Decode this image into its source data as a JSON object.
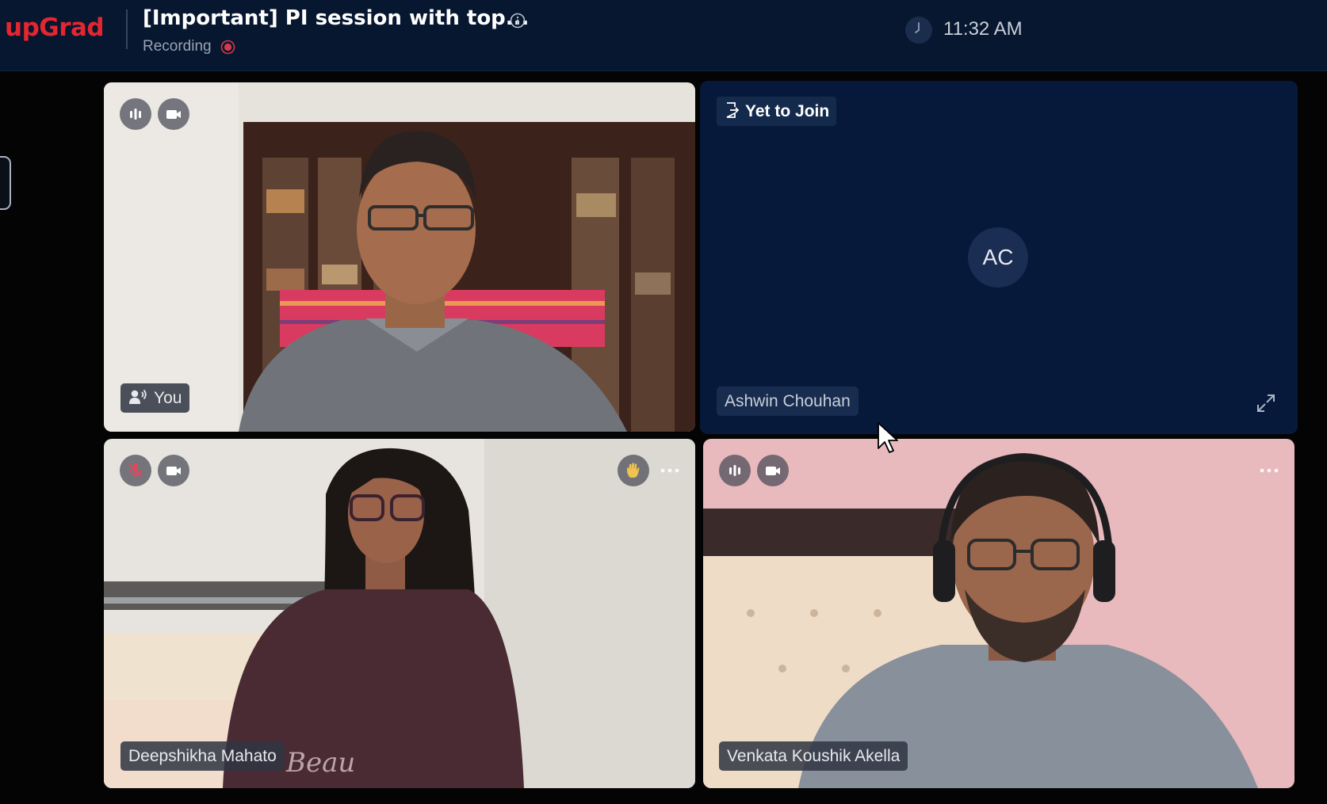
{
  "header": {
    "logo": "upGrad",
    "session_title": "[Important] PI session with top...",
    "recording_label": "Recording",
    "time": "11:32 AM"
  },
  "tiles": [
    {
      "name_label": "You",
      "icons": [
        "audio-level-icon",
        "camera-icon",
        "speaker-icon"
      ],
      "scene": "man in grey shirt, glasses, in front of wooden bookshelf"
    },
    {
      "status": "Yet to Join",
      "initials": "AC",
      "name_label": "Ashwin Chouhan",
      "icons": [
        "join-icon",
        "expand-icon"
      ]
    },
    {
      "name_label": "Deepshikha Mahato",
      "icons": [
        "mic-muted-icon",
        "camera-icon",
        "raised-hand-icon",
        "more-icon"
      ],
      "scene": "woman with glasses and long dark hair, maroon top"
    },
    {
      "name_label": "Venkata Koushik Akella",
      "icons": [
        "audio-level-icon",
        "camera-icon",
        "more-icon"
      ],
      "scene": "man with headphones and glasses, grey t-shirt, pink wall"
    }
  ],
  "colors": {
    "header_bg": "#07172f",
    "page_bg": "#040404",
    "logo_red": "#e3262f",
    "tile_navy": "#07193a",
    "raised_hand": "#f0c34e"
  }
}
